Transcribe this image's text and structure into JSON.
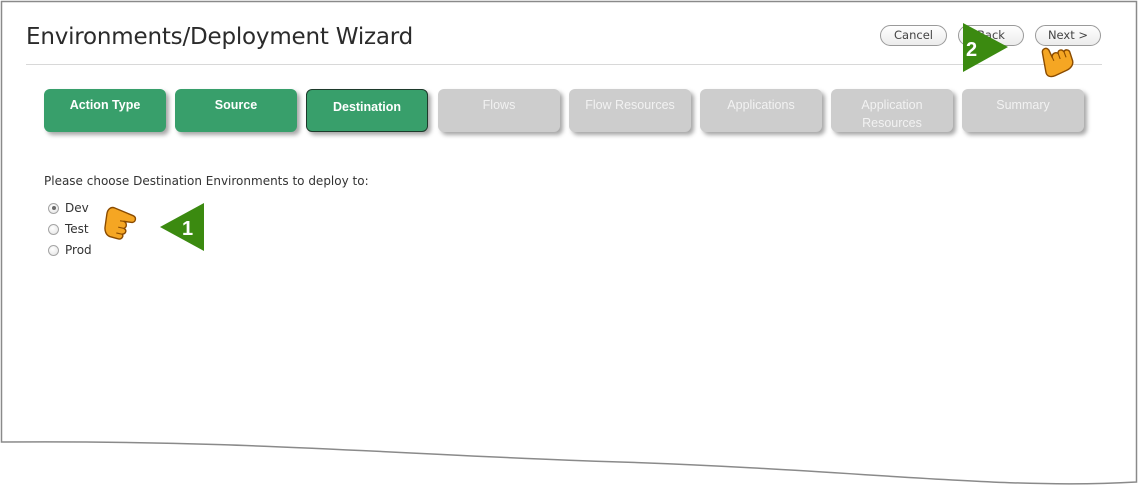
{
  "page": {
    "title": "Environments/Deployment Wizard"
  },
  "toolbar": {
    "cancel_label": "Cancel",
    "back_label": "Back",
    "next_label": "Next >"
  },
  "steps": [
    {
      "line1": "Action Type",
      "line2": "",
      "state": "done"
    },
    {
      "line1": "Source",
      "line2": "",
      "state": "done"
    },
    {
      "line1": "Destination",
      "line2": "",
      "state": "current"
    },
    {
      "line1": "Flows",
      "line2": "",
      "state": "todo"
    },
    {
      "line1": "Flow Resources",
      "line2": "",
      "state": "todo"
    },
    {
      "line1": "Applications",
      "line2": "",
      "state": "todo"
    },
    {
      "line1": "Application",
      "line2": "Resources",
      "state": "todo"
    },
    {
      "line1": "Summary",
      "line2": "",
      "state": "todo"
    }
  ],
  "form": {
    "prompt": "Please choose Destination Environments to deploy to:",
    "options": [
      {
        "label": "Dev",
        "selected": true
      },
      {
        "label": "Test",
        "selected": false
      },
      {
        "label": "Prod",
        "selected": false
      }
    ]
  },
  "callouts": [
    {
      "number": "1"
    },
    {
      "number": "2"
    }
  ],
  "colors": {
    "step_done": "#389f6b",
    "step_todo": "#cdcdcd",
    "callout_green": "#3b8a10",
    "pointer_orange": "#f5a623"
  }
}
